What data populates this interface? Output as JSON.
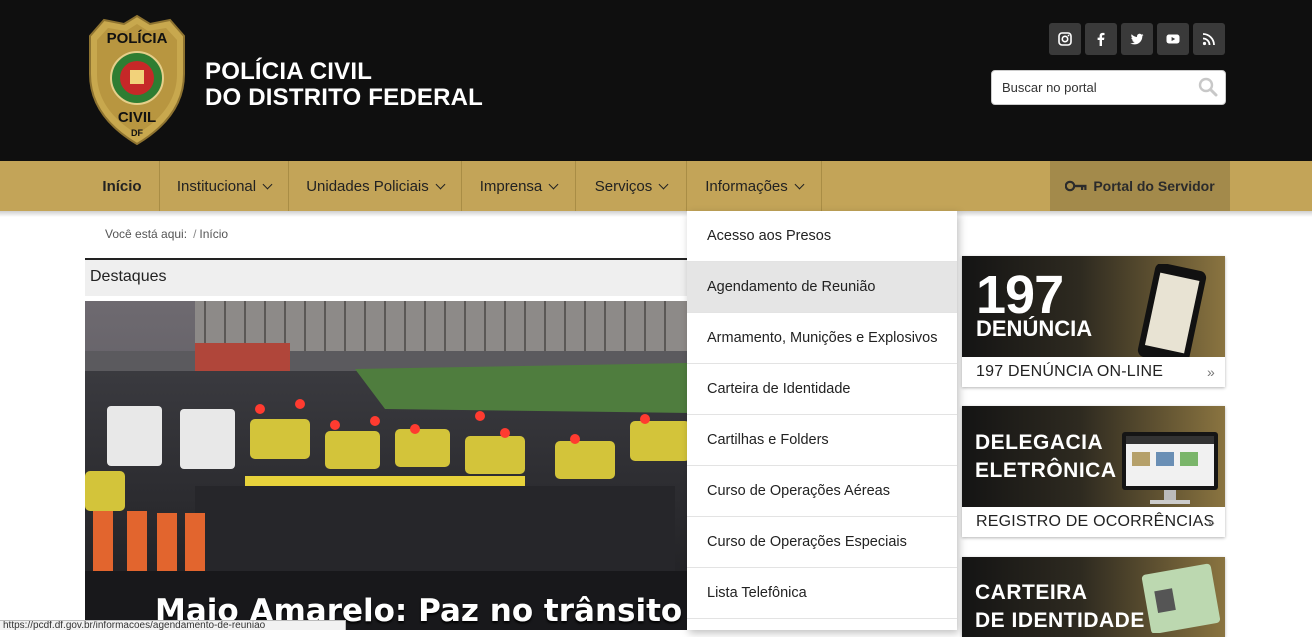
{
  "header": {
    "brand_line1": "POLÍCIA CIVIL",
    "brand_line2": "DO DISTRITO FEDERAL",
    "badge_text_top": "POLÍCIA",
    "badge_text_bottom": "CIVIL",
    "badge_text_df": "DF",
    "social": [
      {
        "icon": "instagram-icon"
      },
      {
        "icon": "facebook-icon"
      },
      {
        "icon": "twitter-icon"
      },
      {
        "icon": "youtube-icon"
      },
      {
        "icon": "rss-icon"
      }
    ],
    "search_placeholder": "Buscar no portal"
  },
  "nav": {
    "items": [
      "Início",
      "Institucional",
      "Unidades Policiais",
      "Imprensa",
      "Serviços",
      "Informações"
    ],
    "portal_label": "Portal do Servidor"
  },
  "breadcrumb": {
    "prefix": "Você está aqui:",
    "current": "Início"
  },
  "destaques": {
    "title": "Destaques",
    "caption": "Maio Amarelo: Paz no trânsito come"
  },
  "dropdown": {
    "items": [
      "Acesso aos Presos",
      "Agendamento de Reunião",
      "Armamento, Munições e Explosivos",
      "Carteira de Identidade",
      "Cartilhas e Folders",
      "Curso de Operações Aéreas",
      "Curso de Operações Especiais",
      "Lista Telefônica"
    ],
    "hovered_index": 1
  },
  "banners": {
    "b1_big": "197",
    "b1_small": "DENÚNCIA",
    "b1_link": "197 DENÚNCIA ON-LINE",
    "b2_line1": "DELEGACIA",
    "b2_line2": "ELETRÔNICA",
    "b2_link": "REGISTRO DE OCORRÊNCIAS",
    "b3_line1": "CARTEIRA",
    "b3_line2": "DE IDENTIDADE",
    "arrow": "»"
  },
  "statusbar": {
    "text": "https://pcdf.df.gov.br/informacoes/agendamento-de-reuniao"
  },
  "colors": {
    "header_bg": "#0f0f0f",
    "nav_gold": "#c3a458",
    "portal_bg": "#a38a4b"
  }
}
